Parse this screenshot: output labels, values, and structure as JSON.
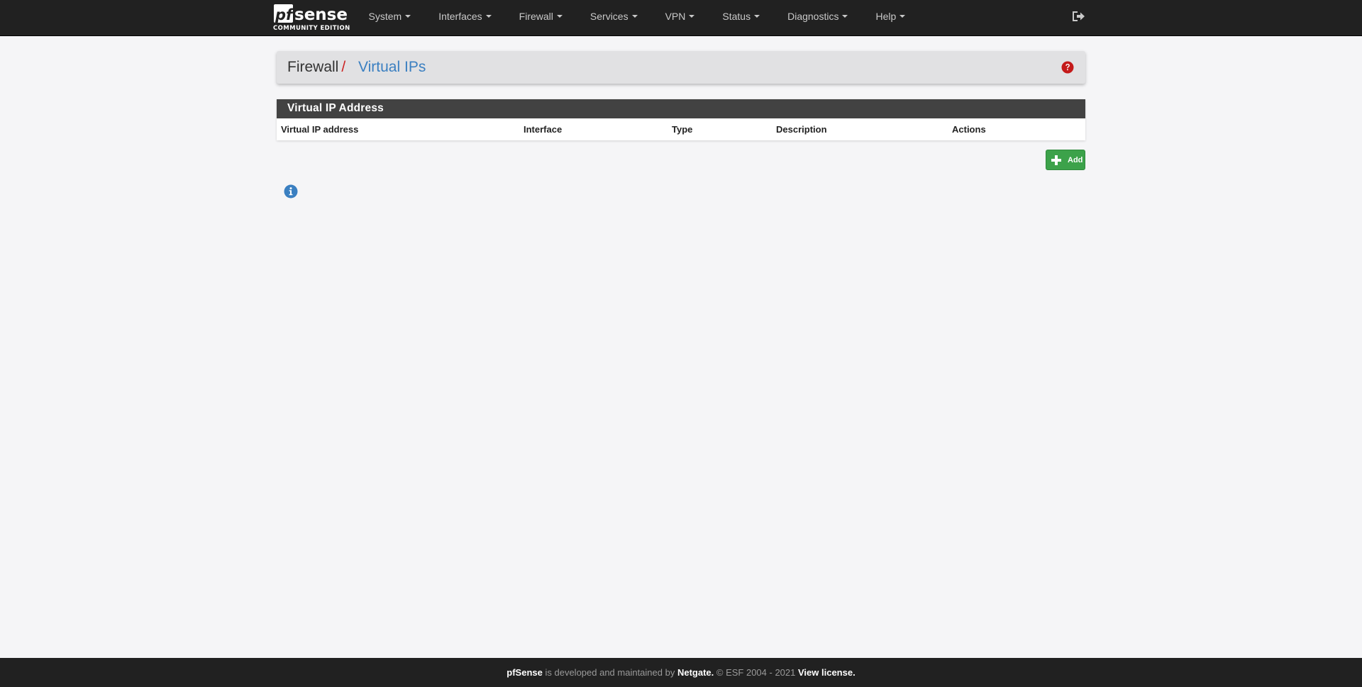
{
  "brand": {
    "logo_wordmark": "pfsense",
    "logo_subtitle": "COMMUNITY EDITION"
  },
  "nav": {
    "items": [
      {
        "label": "System"
      },
      {
        "label": "Interfaces"
      },
      {
        "label": "Firewall"
      },
      {
        "label": "Services"
      },
      {
        "label": "VPN"
      },
      {
        "label": "Status"
      },
      {
        "label": "Diagnostics"
      },
      {
        "label": "Help"
      }
    ],
    "logout_icon": "sign-out-icon"
  },
  "breadcrumb": {
    "parent": "Firewall",
    "separator": "/",
    "current": "Virtual IPs",
    "help_icon": "question-circle-icon"
  },
  "panel": {
    "title": "Virtual IP Address",
    "columns": [
      "Virtual IP address",
      "Interface",
      "Type",
      "Description",
      "Actions"
    ],
    "rows": []
  },
  "actions": {
    "add_label": "Add",
    "add_icon": "plus-icon"
  },
  "info": {
    "icon": "info-circle-icon"
  },
  "footer": {
    "product": "pfSense",
    "text1": "is developed and maintained by",
    "company": "Netgate.",
    "copyright": "© ESF 2004 - 2021",
    "license": "View license."
  },
  "colors": {
    "navbar_bg": "#212121",
    "page_bg": "#f5f5f7",
    "breadcrumb_bg": "#e1e1e3",
    "panel_heading_bg": "#424242",
    "link_blue": "#3a7fc1",
    "separator_red": "#cc2222",
    "add_green": "#3ca24a",
    "help_red": "#c41a1a",
    "info_blue": "#3a7fc1"
  }
}
